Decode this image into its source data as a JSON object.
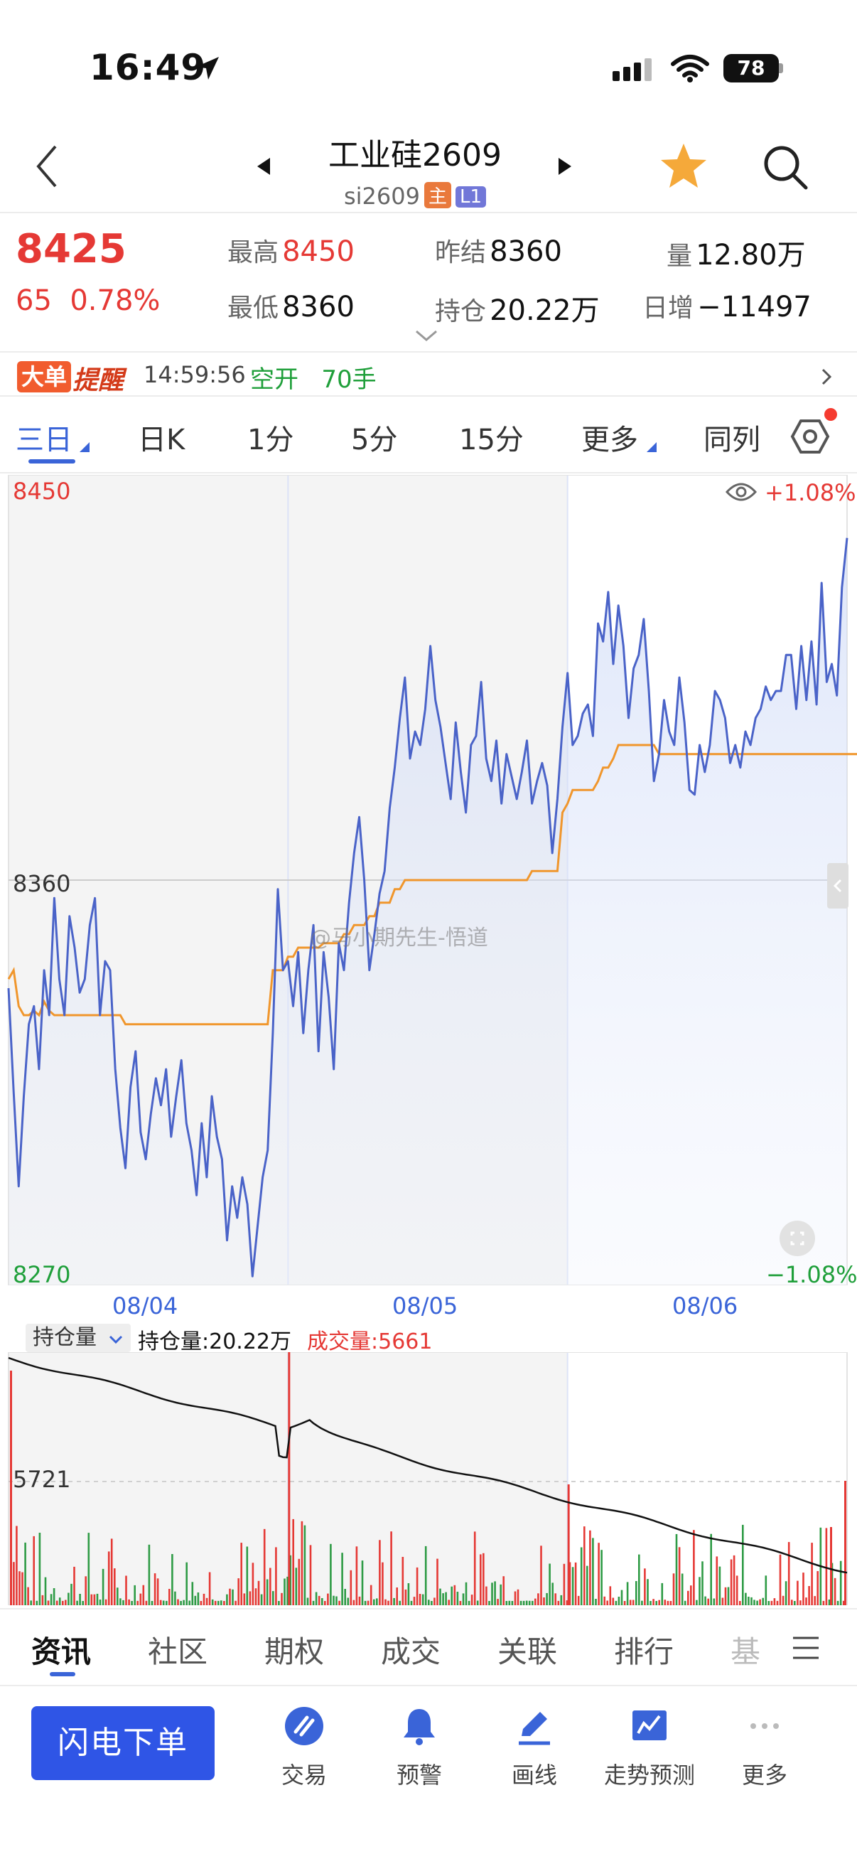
{
  "status": {
    "time": "16:49",
    "battery": "78"
  },
  "nav": {
    "title": "工业硅2609",
    "code": "si2609",
    "badge_main": "主",
    "badge_l1": "L1"
  },
  "quote": {
    "price": "8425",
    "change": "65",
    "change_pct": "0.78%",
    "high_label": "最高",
    "high": "8450",
    "low_label": "最低",
    "low": "8360",
    "prev_settle_label": "昨结",
    "prev_settle": "8360",
    "oi_label": "持仓",
    "oi": "20.22万",
    "volume_label": "量",
    "volume": "12.80万",
    "daily_inc_label": "日增",
    "daily_inc": "−11497"
  },
  "alert": {
    "badge": "大单",
    "title": "提醒",
    "time": "14:59:56",
    "text": "空开   70手"
  },
  "tabs": [
    "三日",
    "日K",
    "1分",
    "5分",
    "15分",
    "更多",
    "同列"
  ],
  "chart": {
    "top_price": "8450",
    "mid_price": "8360",
    "low_price": "8270",
    "top_pct": "+1.08%",
    "low_pct": "−1.08%",
    "watermark": "@马小期先生-悟道",
    "dates": [
      "08/04",
      "08/05",
      "08/06"
    ]
  },
  "sub": {
    "selector": "持仓量",
    "oi_text": "持仓量:20.22万",
    "vol_text": "成交量:5661",
    "vol_tick": "5721"
  },
  "chart_data": {
    "type": "line",
    "title": "",
    "x": [
      "08/04",
      "08/05",
      "08/06"
    ],
    "ylim": [
      8270,
      8450
    ],
    "series": [
      {
        "name": "",
        "values": [
          8336,
          8313,
          8292,
          8312,
          8328,
          8332,
          8318,
          8340,
          8330,
          8356,
          8338,
          8330,
          8352,
          8345,
          8335,
          8338,
          8350,
          8356,
          8330,
          8342,
          8340,
          8318,
          8305,
          8296,
          8314,
          8322,
          8304,
          8298,
          8308,
          8316,
          8310,
          8318,
          8303,
          8312,
          8320,
          8306,
          8300,
          8290,
          8306,
          8294,
          8312,
          8303,
          8298,
          8280,
          8292,
          8285,
          8294,
          8288,
          8272,
          8283,
          8294,
          8300,
          8326,
          8358,
          8340,
          8342,
          8332,
          8344,
          8326,
          8340,
          8350,
          8322,
          8344,
          8334,
          8318,
          8346,
          8340,
          8355,
          8366,
          8374,
          8360,
          8340,
          8348,
          8357,
          8362,
          8376,
          8385,
          8396,
          8405,
          8387,
          8393,
          8390,
          8398,
          8412,
          8400,
          8394,
          8386,
          8378,
          8395,
          8384,
          8375,
          8390,
          8392,
          8404,
          8387,
          8382,
          8391,
          8377,
          8388,
          8383,
          8378,
          8384,
          8391,
          8377,
          8382,
          8386,
          8381,
          8366,
          8378,
          8394,
          8406,
          8390,
          8392,
          8397,
          8399,
          8392,
          8417,
          8413,
          8424,
          8408,
          8421,
          8412,
          8396,
          8407,
          8410,
          8418,
          8402,
          8382,
          8388,
          8400,
          8393,
          8390,
          8405,
          8395,
          8380,
          8379,
          8390,
          8384,
          8390,
          8402,
          8400,
          8396,
          8386,
          8390,
          8385,
          8393,
          8390,
          8396,
          8398,
          8403,
          8400,
          8402,
          8402,
          8410,
          8410,
          8398,
          8412,
          8400,
          8413,
          8399,
          8426,
          8404,
          8408,
          8401,
          8425,
          8436
        ]
      },
      {
        "name": "",
        "values": [
          8338,
          8340,
          8332,
          8330,
          8330,
          8331,
          8330,
          8333,
          8331,
          8330,
          8330,
          8330,
          8330,
          8330,
          8330,
          8330,
          8330,
          8330,
          8330,
          8330,
          8330,
          8330,
          8330,
          8328,
          8328,
          8328,
          8328,
          8328,
          8328,
          8328,
          8328,
          8328,
          8328,
          8328,
          8328,
          8328,
          8328,
          8328,
          8328,
          8328,
          8328,
          8328,
          8328,
          8328,
          8328,
          8328,
          8328,
          8328,
          8328,
          8328,
          8328,
          8328,
          8340,
          8340,
          8340,
          8343,
          8343,
          8345,
          8345,
          8345,
          8345,
          8345,
          8346,
          8346,
          8346,
          8346,
          8348,
          8348,
          8350,
          8350,
          8350,
          8352,
          8352,
          8355,
          8355,
          8355,
          8358,
          8358,
          8360,
          8360,
          8360,
          8360,
          8360,
          8360,
          8360,
          8360,
          8360,
          8360,
          8360,
          8360,
          8360,
          8360,
          8360,
          8360,
          8360,
          8360,
          8360,
          8360,
          8360,
          8360,
          8360,
          8360,
          8360,
          8362,
          8362,
          8362,
          8362,
          8362,
          8362,
          8375,
          8377,
          8380,
          8380,
          8380,
          8380,
          8380,
          8382,
          8385,
          8385,
          8387,
          8390,
          8390,
          8390,
          8390,
          8390,
          8390,
          8390,
          8390,
          8388,
          8388,
          8388,
          8388,
          8388,
          8388,
          8388,
          8388,
          8388,
          8388,
          8388,
          8388,
          8388,
          8388,
          8388,
          8388,
          8388,
          8388,
          8388,
          8388,
          8388,
          8388,
          8388,
          8388,
          8388,
          8388,
          8388,
          8388,
          8388,
          8388,
          8388,
          8388,
          8388,
          8388,
          8388,
          8388,
          8388,
          8388,
          8388,
          8388,
          8388,
          8390
        ]
      }
    ]
  },
  "bottom_tabs": [
    "资讯",
    "社区",
    "期权",
    "成交",
    "关联",
    "排行",
    "基"
  ],
  "actions": {
    "flash": "闪电下单",
    "items": [
      "交易",
      "预警",
      "画线",
      "走势预测",
      "更多"
    ]
  },
  "colors": {
    "accent": "#3a64d8",
    "up": "#e53935",
    "down": "#1f9f3a",
    "avg": "#f0962c"
  }
}
